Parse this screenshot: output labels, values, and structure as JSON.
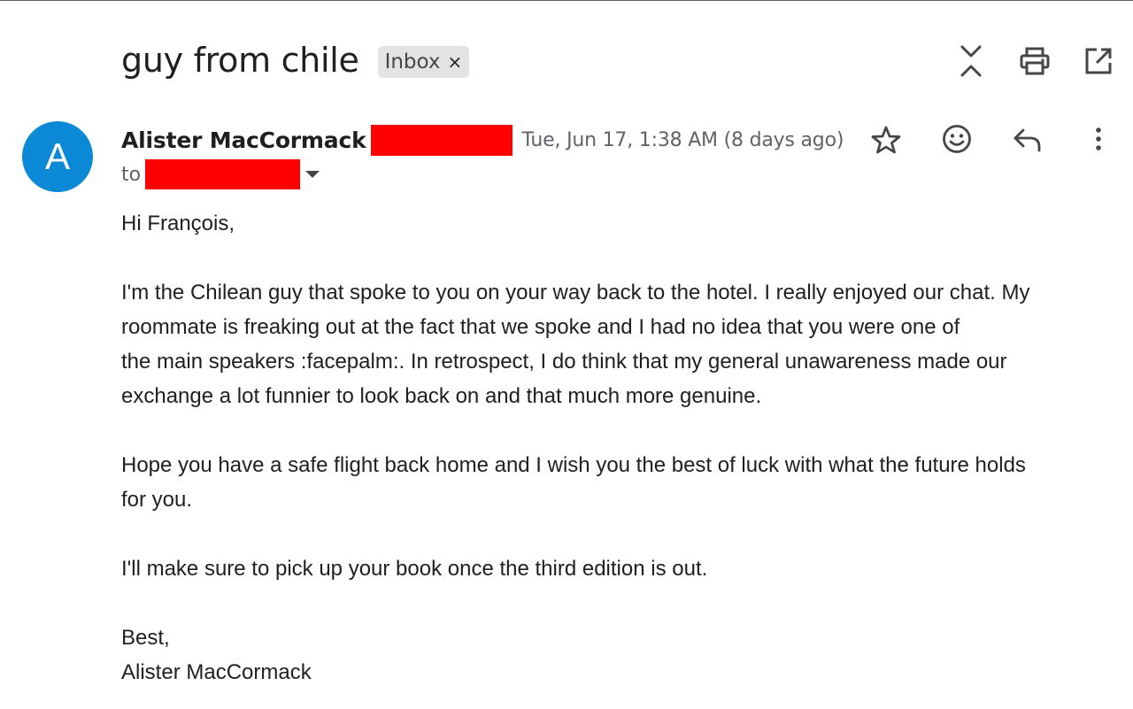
{
  "email": {
    "subject": "guy from chile",
    "label": "Inbox",
    "label_remove": "×",
    "avatar_letter": "A",
    "sender_name": "Alister MacCormack",
    "timestamp": "Tue, Jun 17, 1:38 AM (8 days ago)",
    "to_label": "to",
    "body": {
      "greeting": "Hi François,",
      "para1_line1": "I'm the Chilean guy that spoke to you on your way back to the hotel. I really enjoyed our chat. My",
      "para1_line2": "roommate is freaking out at the fact that we spoke and I had no idea that you were one of",
      "para1_line3": "the main speakers :facepalm:. In retrospect, I do think that my general unawareness made our",
      "para1_line4": "exchange a lot funnier to look back on and that much more genuine.",
      "para2_line1": "Hope you have a safe flight back home and I wish you the best of luck with what the future holds",
      "para2_line2": "for you.",
      "para3": "I'll make sure to pick up your book once the third edition is out.",
      "closing": "Best,",
      "signature": "Alister MacCormack"
    }
  },
  "icons": {
    "collapse": "collapse-all-icon",
    "print": "print-icon",
    "open_new_window": "open-in-new-window-icon",
    "star": "star-icon",
    "emoji": "emoji-reaction-icon",
    "reply": "reply-icon",
    "more": "more-vert-icon"
  },
  "colors": {
    "avatar_bg": "#0b88d6",
    "redaction": "#ff0000",
    "chip_bg": "#e3e3e3"
  }
}
